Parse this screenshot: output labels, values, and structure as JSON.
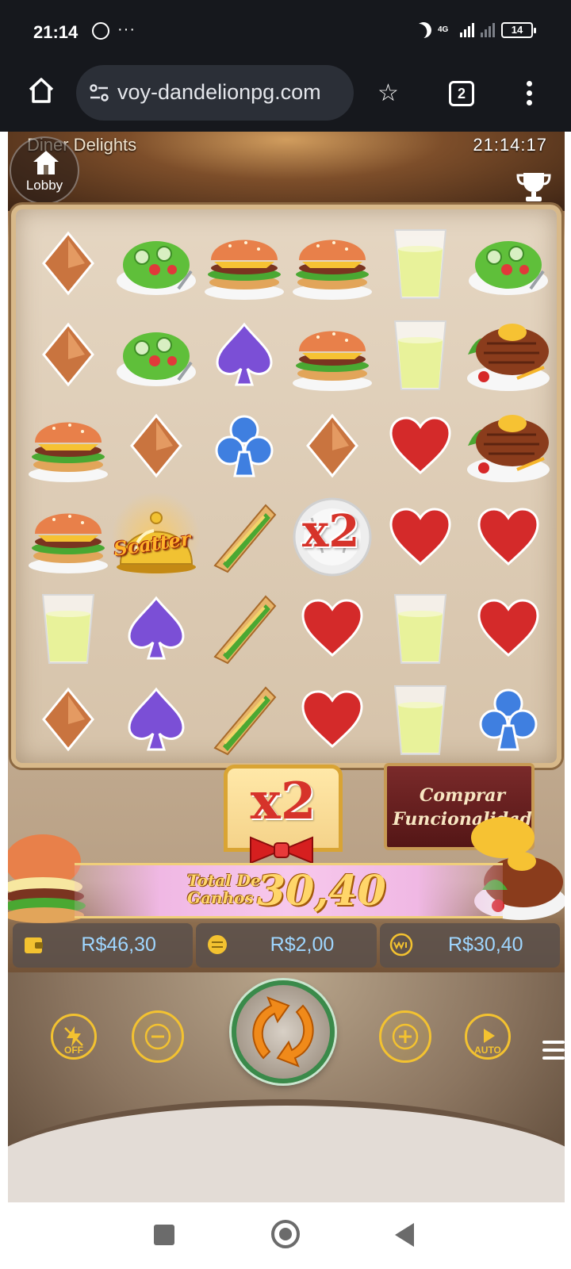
{
  "status_bar": {
    "time": "21:14",
    "dots": "···",
    "network": "4G",
    "battery": "14"
  },
  "browser": {
    "url": "voy-dandelionpg.com",
    "tab_count": "2"
  },
  "game": {
    "title": "Diner Delights",
    "clock": "21:14:17",
    "lobby_label": "Lobby",
    "grid": [
      [
        "diamond",
        "salad",
        "burger",
        "burger",
        "lemonade",
        "salad"
      ],
      [
        "diamond",
        "salad",
        "spade",
        "burger",
        "lemonade",
        "steak"
      ],
      [
        "burger",
        "diamond",
        "club",
        "diamond",
        "heart",
        "steak"
      ],
      [
        "burger",
        "scatter",
        "sandwich",
        "multiplier-x2",
        "heart",
        "heart"
      ],
      [
        "lemonade",
        "spade",
        "sandwich",
        "heart",
        "lemonade",
        "heart"
      ],
      [
        "diamond",
        "spade",
        "sandwich",
        "heart",
        "lemonade",
        "club"
      ]
    ],
    "scatter_label": "Scatter",
    "cell_multiplier_label": "x2",
    "multiplier": "x2",
    "buy_feature_label": "Comprar\nFuncionalidad",
    "total_win_label": "Total De\nGanhos",
    "total_win_amount": "30,40",
    "balance": "R$46,30",
    "bet": "R$2,00",
    "win": "R$30,40",
    "turbo_label": "OFF",
    "auto_label": "AUTO",
    "colors": {
      "diamond": "#c9743f",
      "spade": "#7b4fd6",
      "club": "#3f7fe0",
      "heart": "#d42a2a",
      "stat_text": "#9fd6ff",
      "gold": "#f3c230"
    }
  }
}
